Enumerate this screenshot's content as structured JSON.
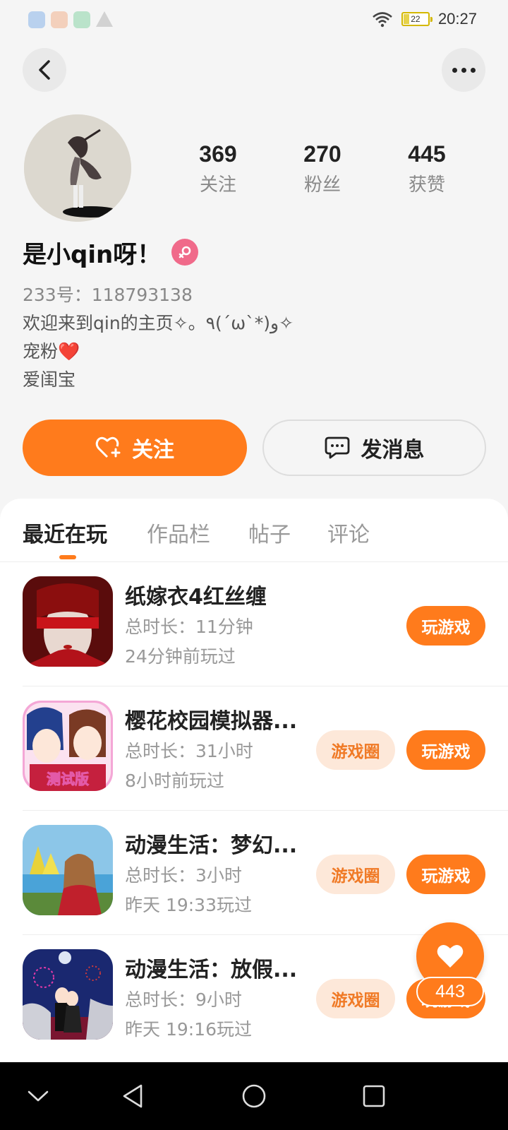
{
  "status_bar": {
    "time": "20:27",
    "battery": "22"
  },
  "profile": {
    "stats": [
      {
        "num": "369",
        "label": "关注"
      },
      {
        "num": "270",
        "label": "粉丝"
      },
      {
        "num": "445",
        "label": "获赞"
      }
    ],
    "username": "是小qin呀！",
    "uid": "233号：118793138",
    "bio": [
      "欢迎来到qin的主页✧。٩(ˊωˋ*)و✧",
      "宠粉❤️",
      "爱闺宝"
    ]
  },
  "actions": {
    "follow": "关注",
    "message": "发消息"
  },
  "tabs": [
    "最近在玩",
    "作品栏",
    "帖子",
    "评论"
  ],
  "games": [
    {
      "title": "纸嫁衣4红丝缠",
      "duration": "总时长：11分钟",
      "last_played": "24分钟前玩过",
      "circle": "",
      "play": "玩游戏"
    },
    {
      "title": "樱花校园模拟器...",
      "duration": "总时长：31小时",
      "last_played": "8小时前玩过",
      "circle": "游戏圈",
      "play": "玩游戏",
      "icon_text": "测试版"
    },
    {
      "title": "动漫生活：梦幻...",
      "duration": "总时长：3小时",
      "last_played": "昨天 19:33玩过",
      "circle": "游戏圈",
      "play": "玩游戏"
    },
    {
      "title": "动漫生活：放假...",
      "duration": "总时长：9小时",
      "last_played": "昨天 19:16玩过",
      "circle": "游戏圈",
      "play": "玩游戏"
    }
  ],
  "float_like": {
    "count": "443"
  },
  "colors": {
    "accent": "#ff7b1c",
    "circle_bg": "#fde8d9",
    "gender": "#f06a8a"
  }
}
